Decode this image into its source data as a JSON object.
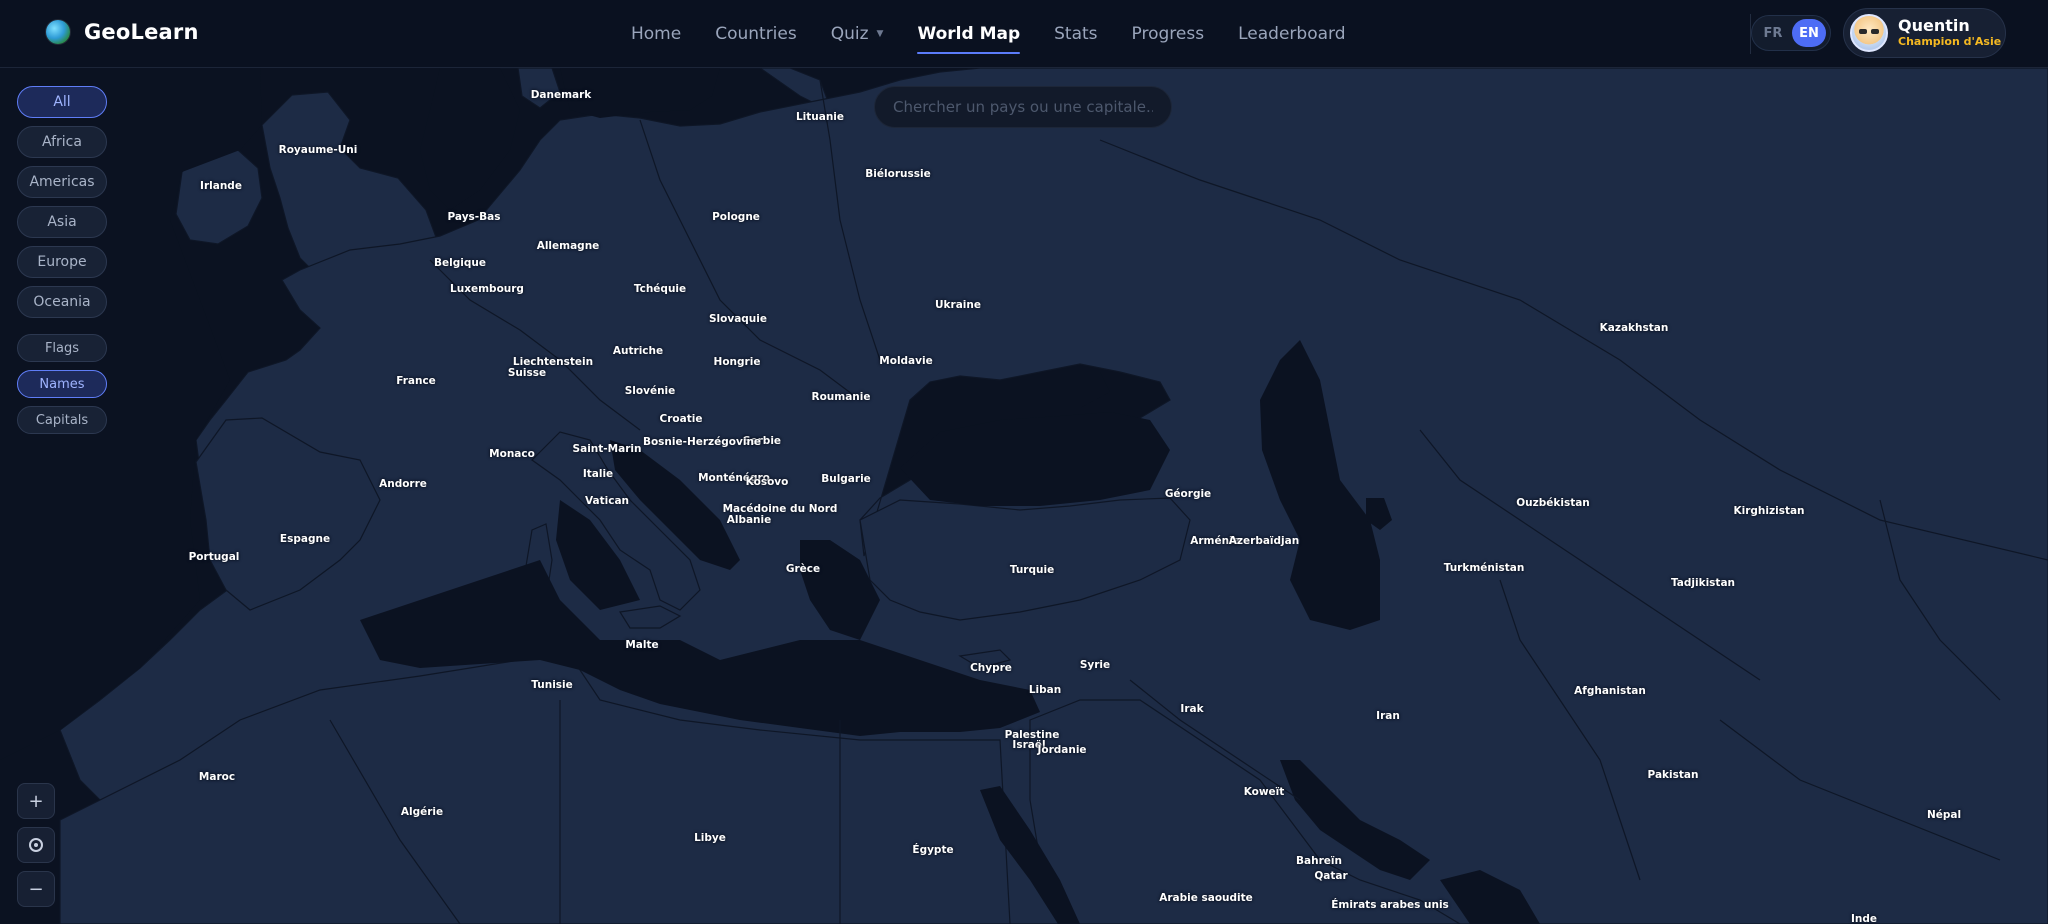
{
  "app": {
    "name": "GeoLearn"
  },
  "nav": [
    {
      "label": "Home",
      "active": false
    },
    {
      "label": "Countries",
      "active": false
    },
    {
      "label": "Quiz",
      "active": false,
      "dropdown": true
    },
    {
      "label": "World Map",
      "active": true
    },
    {
      "label": "Stats",
      "active": false
    },
    {
      "label": "Progress",
      "active": false
    },
    {
      "label": "Leaderboard",
      "active": false
    }
  ],
  "language": {
    "options": [
      "FR",
      "EN"
    ],
    "selected": "EN"
  },
  "user": {
    "name": "Quentin",
    "rank": "Champion d'Asie"
  },
  "search": {
    "placeholder": "Chercher un pays ou une capitale..."
  },
  "region_filters": [
    {
      "label": "All",
      "active": true
    },
    {
      "label": "Africa",
      "active": false
    },
    {
      "label": "Americas",
      "active": false
    },
    {
      "label": "Asia",
      "active": false
    },
    {
      "label": "Europe",
      "active": false
    },
    {
      "label": "Oceania",
      "active": false
    }
  ],
  "display_modes": [
    {
      "label": "Flags",
      "active": false
    },
    {
      "label": "Names",
      "active": true
    },
    {
      "label": "Capitals",
      "active": false
    }
  ],
  "zoom_controls": {
    "zoom_in": "+",
    "zoom_out": "−"
  },
  "colors": {
    "land": "#1d2b45",
    "sea": "#0b1221",
    "border": "#0e1626",
    "accent": "#5b7cfa",
    "rank": "#f5b922"
  },
  "country_labels": [
    "Danemark",
    "Lituanie",
    "Royaume-Uni",
    "Irlande",
    "Biélorussie",
    "Pays-Bas",
    "Pologne",
    "Allemagne",
    "Belgique",
    "Luxembourg",
    "Tchéquie",
    "Ukraine",
    "Slovaquie",
    "Kazakhstan",
    "Liechtenstein",
    "Suisse",
    "Autriche",
    "Hongrie",
    "Moldavie",
    "France",
    "Slovénie",
    "Roumanie",
    "Croatie",
    "Serbie",
    "Bosnie-Herzégovine",
    "Monaco",
    "Saint-Marin",
    "Italie",
    "Monténégro",
    "Kosovo",
    "Bulgarie",
    "Andorre",
    "Vatican",
    "Macédoine du Nord",
    "Albanie",
    "Géorgie",
    "Ouzbékistan",
    "Kirghizistan",
    "Arménie",
    "Azerbaïdjan",
    "Espagne",
    "Portugal",
    "Grèce",
    "Turquie",
    "Turkménistan",
    "Tadjikistan",
    "Malte",
    "Chypre",
    "Syrie",
    "Tunisie",
    "Liban",
    "Afghanistan",
    "Irak",
    "Iran",
    "Palestine",
    "Israël",
    "Jordanie",
    "Maroc",
    "Pakistan",
    "Koweït",
    "Algérie",
    "Népal",
    "Libye",
    "Égypte",
    "Bahreïn",
    "Qatar",
    "Arabie saoudite",
    "Émirats arabes unis",
    "Inde"
  ]
}
